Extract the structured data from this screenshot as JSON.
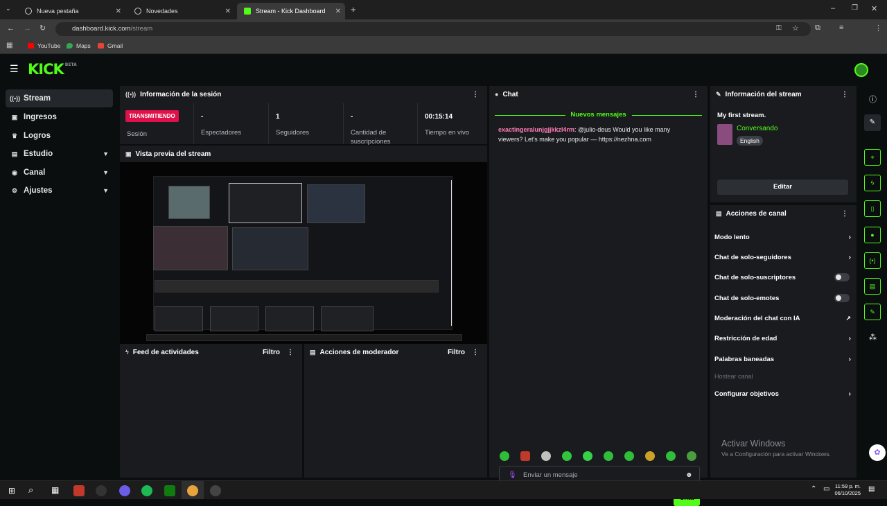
{
  "browser": {
    "tabs": [
      {
        "label": "Nueva pestaña"
      },
      {
        "label": "Novedades"
      },
      {
        "label": "Stream - Kick Dashboard"
      }
    ],
    "url_host": "dashboard.kick.com",
    "url_path": "/stream",
    "bookmarks": [
      {
        "label": "YouTube",
        "color": "#ff0000"
      },
      {
        "label": "Maps",
        "color": "#34a853"
      },
      {
        "label": "Gmail",
        "color": "#ea4335"
      }
    ]
  },
  "app": {
    "logo": "KICK",
    "logo_badge": "BETA",
    "accent": "#53fc18"
  },
  "sidebar": {
    "items": [
      {
        "label": "Stream",
        "icon": "broadcast-icon",
        "active": true
      },
      {
        "label": "Ingresos",
        "icon": "income-icon"
      },
      {
        "label": "Logros",
        "icon": "trophy-icon"
      },
      {
        "label": "Estudio",
        "icon": "studio-icon",
        "expandable": true
      },
      {
        "label": "Canal",
        "icon": "channel-icon",
        "expandable": true
      },
      {
        "label": "Ajustes",
        "icon": "gear-icon",
        "expandable": true
      }
    ]
  },
  "session": {
    "title": "Información de la sesión",
    "badge": "TRANSMITIENDO",
    "badge_label": "Sesión",
    "stats": [
      {
        "value": "-",
        "label": "Espectadores"
      },
      {
        "value": "1",
        "label": "Seguidores"
      },
      {
        "value": "-",
        "label": "Cantidad de suscripciones"
      },
      {
        "value": "00:15:14",
        "label": "Tiempo en vivo"
      }
    ]
  },
  "preview": {
    "title": "Vista previa del stream"
  },
  "activity": {
    "title": "Feed de actividades",
    "filter": "Filtro"
  },
  "moderator": {
    "title": "Acciones de moderador",
    "filter": "Filtro"
  },
  "chat": {
    "title": "Chat",
    "new_messages": "Nuevos mensajes",
    "messages": [
      {
        "user": "exactingeralunjgjjkkzl4rm",
        "text": ": @julio-deus Would you like many viewers? Let's make you popular — https://nezhna.com"
      }
    ],
    "input_placeholder": "Enviar un mensaje",
    "send_label": "Chat"
  },
  "stream_info": {
    "title": "Información del stream",
    "stream_title": "My first stream.",
    "category": "Conversando",
    "language": "English",
    "edit_label": "Editar"
  },
  "channel_actions": {
    "title": "Acciones de canal",
    "items": [
      {
        "label": "Modo lento",
        "control": "chevron"
      },
      {
        "label": "Chat de solo-seguidores",
        "control": "chevron"
      },
      {
        "label": "Chat de solo-suscriptores",
        "control": "toggle",
        "on": false
      },
      {
        "label": "Chat de solo-emotes",
        "control": "toggle",
        "on": false
      },
      {
        "label": "Moderación del chat con IA",
        "control": "external"
      },
      {
        "label": "Restricción de edad",
        "control": "chevron"
      },
      {
        "label": "Palabras baneadas",
        "control": "chevron"
      },
      {
        "label": "Hostear canal",
        "control": "none",
        "disabled": true
      },
      {
        "label": "Configurar objetivos",
        "control": "chevron"
      }
    ]
  },
  "watermark": {
    "line1": "Activar Windows",
    "line2": "Ve a Configuración para activar Windows."
  },
  "taskbar": {
    "time": "11:59 p. m.",
    "date": "06/10/2025"
  }
}
